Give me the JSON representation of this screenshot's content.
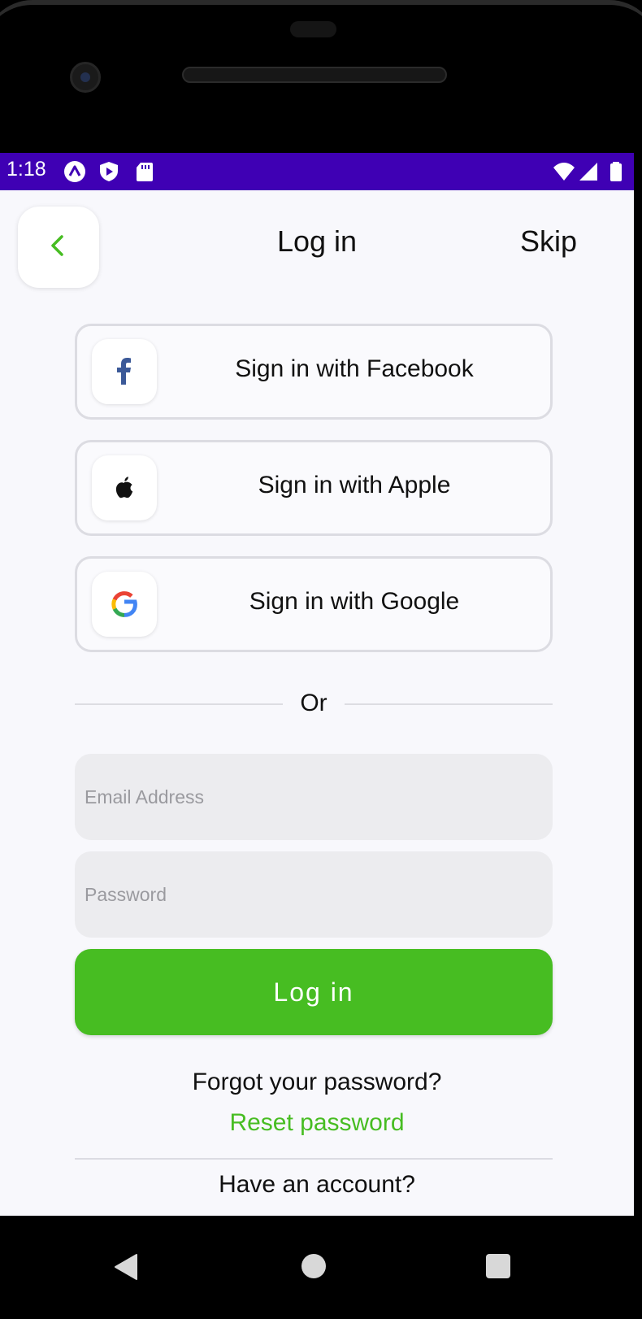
{
  "status_bar": {
    "time": "1:18",
    "icons_left": [
      "app-a-icon",
      "shield-play-icon",
      "sd-card-icon"
    ],
    "icons_right": [
      "wifi-icon",
      "signal-icon",
      "battery-icon"
    ],
    "background": "#3f00b4"
  },
  "header": {
    "back_icon": "chevron-left-icon",
    "title": "Log in",
    "skip_label": "Skip"
  },
  "social_buttons": [
    {
      "icon": "facebook-icon",
      "label": "Sign in with Facebook"
    },
    {
      "icon": "apple-icon",
      "label": "Sign in with Apple"
    },
    {
      "icon": "google-icon",
      "label": "Sign in with Google"
    }
  ],
  "separator_text": "Or",
  "form": {
    "email_placeholder": "Email Address",
    "email_value": "",
    "password_placeholder": "Password",
    "password_value": "",
    "submit_label": "Log in"
  },
  "footer": {
    "forgot_text": "Forgot your password?",
    "reset_link": "Reset password",
    "have_account_text": "Have an account?"
  },
  "colors": {
    "accent": "#47bd22",
    "screen_background": "#f8f8fc",
    "field_background": "#ececef"
  },
  "nav_bar": {
    "icons": [
      "nav-back-icon",
      "nav-home-icon",
      "nav-recents-icon"
    ]
  }
}
